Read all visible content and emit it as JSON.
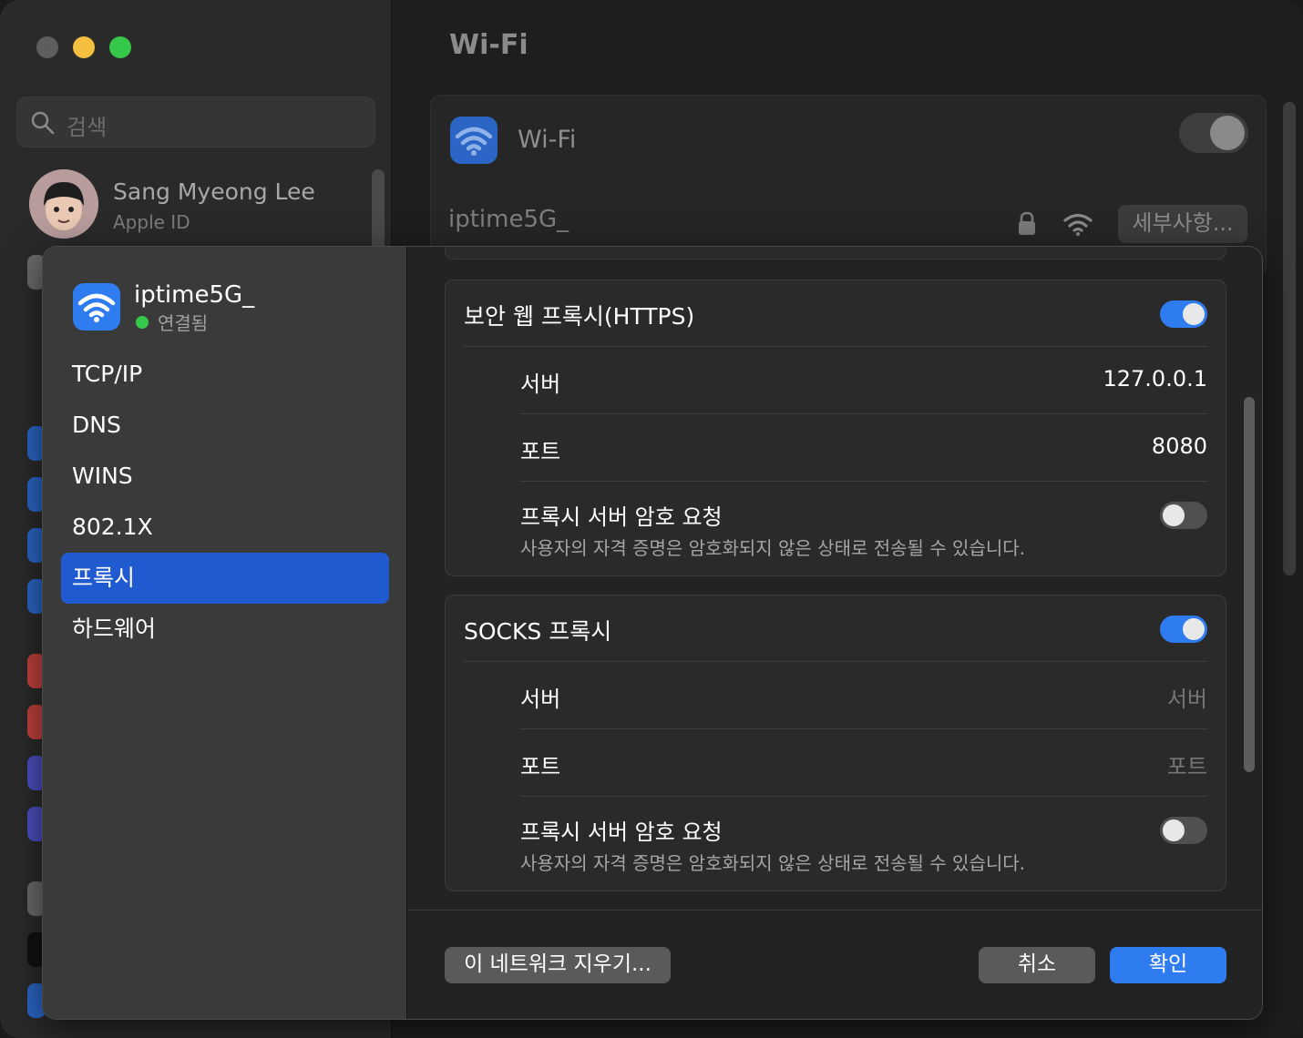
{
  "window": {
    "title": "Wi-Fi"
  },
  "sidebar": {
    "search_placeholder": "검색",
    "account_name": "Sang Myeong Lee",
    "account_sub": "Apple ID"
  },
  "main": {
    "wifi_label": "Wi-Fi",
    "network_name": "iptime5G_",
    "details_button": "세부사항..."
  },
  "modal": {
    "network_name": "iptime5G_",
    "status": "연결됨",
    "nav": [
      "TCP/IP",
      "DNS",
      "WINS",
      "802.1X",
      "프록시",
      "하드웨어"
    ],
    "active_nav": "프록시",
    "https_proxy": {
      "title": "보안 웹 프록시(HTTPS)",
      "enabled": true,
      "server_label": "서버",
      "server_value": "127.0.0.1",
      "port_label": "포트",
      "port_value": "8080",
      "auth_label": "프록시 서버 암호 요청",
      "auth_enabled": false,
      "auth_note": "사용자의 자격 증명은 암호화되지 않은 상태로 전송될 수 있습니다."
    },
    "socks_proxy": {
      "title": "SOCKS 프록시",
      "enabled": true,
      "server_label": "서버",
      "server_placeholder": "서버",
      "port_label": "포트",
      "port_placeholder": "포트",
      "auth_label": "프록시 서버 암호 요청",
      "auth_enabled": false,
      "auth_note": "사용자의 자격 증명은 암호화되지 않은 상태로 전송될 수 있습니다."
    },
    "footer": {
      "forget_button": "이 네트워크 지우기...",
      "cancel_button": "취소",
      "ok_button": "확인"
    }
  },
  "colors": {
    "accent": "#2f7cf0",
    "selection": "#1f5ad1",
    "connected": "#35c84a"
  }
}
